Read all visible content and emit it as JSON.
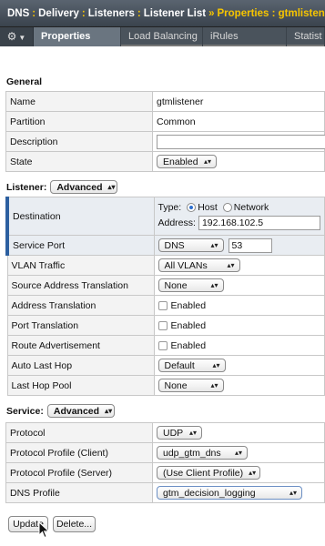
{
  "breadcrumb": {
    "parts": [
      "DNS",
      "Delivery",
      "Listeners",
      "Listener List"
    ],
    "current": "Properties : gtmlistener",
    "sep": ":",
    "sep_last": "»"
  },
  "tabs": [
    {
      "label": "Properties"
    },
    {
      "label": "Load Balancing"
    },
    {
      "label": "iRules"
    },
    {
      "label": "Statist"
    }
  ],
  "general": {
    "title": "General",
    "rows": {
      "name": {
        "label": "Name",
        "value": "gtmlistener"
      },
      "partition": {
        "label": "Partition",
        "value": "Common"
      },
      "description": {
        "label": "Description",
        "value": ""
      },
      "state": {
        "label": "State",
        "value": "Enabled"
      }
    }
  },
  "listener": {
    "title": "Listener:",
    "mode": "Advanced",
    "destination": {
      "label": "Destination",
      "type_label": "Type:",
      "type_options": [
        "Host",
        "Network"
      ],
      "type_selected": "Host",
      "address_label": "Address:",
      "address": "192.168.102.5"
    },
    "service_port": {
      "label": "Service Port",
      "service": "DNS",
      "port": "53"
    },
    "vlan_traffic": {
      "label": "VLAN Traffic",
      "value": "All VLANs"
    },
    "snat": {
      "label": "Source Address Translation",
      "value": "None"
    },
    "address_translation": {
      "label": "Address Translation",
      "value": "Enabled"
    },
    "port_translation": {
      "label": "Port Translation",
      "value": "Enabled"
    },
    "route_advertisement": {
      "label": "Route Advertisement",
      "value": "Enabled"
    },
    "auto_last_hop": {
      "label": "Auto Last Hop",
      "value": "Default"
    },
    "last_hop_pool": {
      "label": "Last Hop Pool",
      "value": "None"
    }
  },
  "service": {
    "title": "Service:",
    "mode": "Advanced",
    "protocol": {
      "label": "Protocol",
      "value": "UDP"
    },
    "profile_client": {
      "label": "Protocol Profile (Client)",
      "value": "udp_gtm_dns"
    },
    "profile_server": {
      "label": "Protocol Profile (Server)",
      "value": "(Use Client Profile)"
    },
    "dns_profile": {
      "label": "DNS Profile",
      "value": "gtm_decision_logging"
    }
  },
  "actions": {
    "update": "Update",
    "delete": "Delete..."
  },
  "colors": {
    "accent": "#2c5fa0",
    "breadcrumb_highlight": "#f5c400",
    "header_bg": "#3a434d"
  },
  "icons": {
    "settings": "gear-icon",
    "cursor": "mouse-pointer-icon"
  }
}
